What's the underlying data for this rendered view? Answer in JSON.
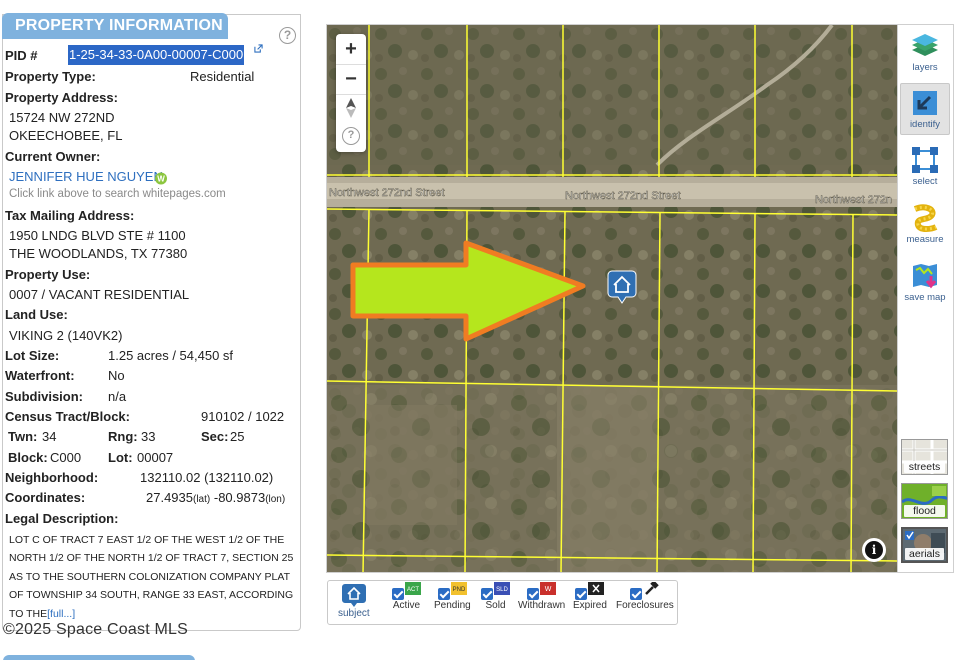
{
  "panel": {
    "title": "PROPERTY INFORMATION",
    "help": "?",
    "pid_label": "PID #",
    "pid_value": "1-25-34-33-0A00-00007-C000",
    "property_type_label": "Property Type:",
    "property_type_value": "Residential",
    "address_label": "Property Address:",
    "address_line1": "15724 NW 272ND",
    "address_line2": "OKEECHOBEE, FL",
    "owner_label": "Current Owner:",
    "owner_name": "JENNIFER HUE NGUYEN",
    "owner_hint": "Click link above to search whitepages.com",
    "mailing_label": "Tax Mailing Address:",
    "mailing_line1": "1950 LNDG BLVD STE # 1100",
    "mailing_line2": "THE WOODLANDS, TX 77380",
    "use_label": "Property Use:",
    "use_value": "0007 / VACANT RESIDENTIAL",
    "land_use_label": "Land Use:",
    "land_use_value": "VIKING 2 (140VK2)",
    "lot_size_label": "Lot Size:",
    "lot_size_value": "1.25 acres / 54,450 sf",
    "waterfront_label": "Waterfront:",
    "waterfront_value": "No",
    "subdivision_label": "Subdivision:",
    "subdivision_value": "n/a",
    "census_label": "Census Tract/Block:",
    "census_value": "910102 / 1022",
    "twn_label": "Twn:",
    "twn_value": "34",
    "rng_label": "Rng:",
    "rng_value": "33",
    "sec_label": "Sec:",
    "sec_value": "25",
    "block_label": "Block:",
    "block_value": "C000",
    "lot_label": "Lot:",
    "lot_value": "00007",
    "neighborhood_label": "Neighborhood:",
    "neighborhood_value": "132110.02 (132110.02)",
    "coords_label": "Coordinates:",
    "coords_lat": "27.4935",
    "coords_lat_unit": "(lat)",
    "coords_lon": "-80.9873",
    "coords_lon_unit": "(lon)",
    "legal_label": "Legal Description:",
    "legal_text": "LOT C OF TRACT 7 EAST 1/2 OF THE WEST 1/2 OF THE NORTH 1/2 OF THE NORTH 1/2 OF TRACT 7, SECTION 25 AS TO THE SOUTHERN COLONIZATION COMPANY PLAT OF TOWNSHIP 34 SOUTH, RANGE 33 EAST, ACCORDING TO THE",
    "legal_more": "[full...]"
  },
  "copyright": "©2025 Space Coast MLS",
  "map": {
    "street_left": "Northwest 272nd Street",
    "street_center": "Northwest 272nd Street",
    "street_right": "Northwest 272n",
    "zoom_in": "+",
    "zoom_out": "−",
    "help": "?",
    "info": "i"
  },
  "toolbar": {
    "layers": "layers",
    "identify": "identify",
    "select": "select",
    "measure": "measure",
    "save_map": "save map",
    "streets": "streets",
    "flood": "flood",
    "aerials": "aerials"
  },
  "legend": {
    "subject": "subject",
    "active": "Active",
    "pending": "Pending",
    "sold": "Sold",
    "withdrawn": "Withdrawn",
    "expired": "Expired",
    "foreclosures": "Foreclosures",
    "badge_active": "ACT",
    "badge_pending": "PND",
    "badge_sold": "SLD",
    "badge_withdrawn": "W"
  },
  "colors": {
    "tab_blue": "#7fb2de",
    "pid_highlight": "#2c67c6",
    "link_blue": "#2e6fbf",
    "parcel_line": "#ffff33",
    "arrow_fill": "#b5e61d",
    "arrow_stroke": "#f07c22",
    "subject_marker": "#2f6fb3"
  }
}
